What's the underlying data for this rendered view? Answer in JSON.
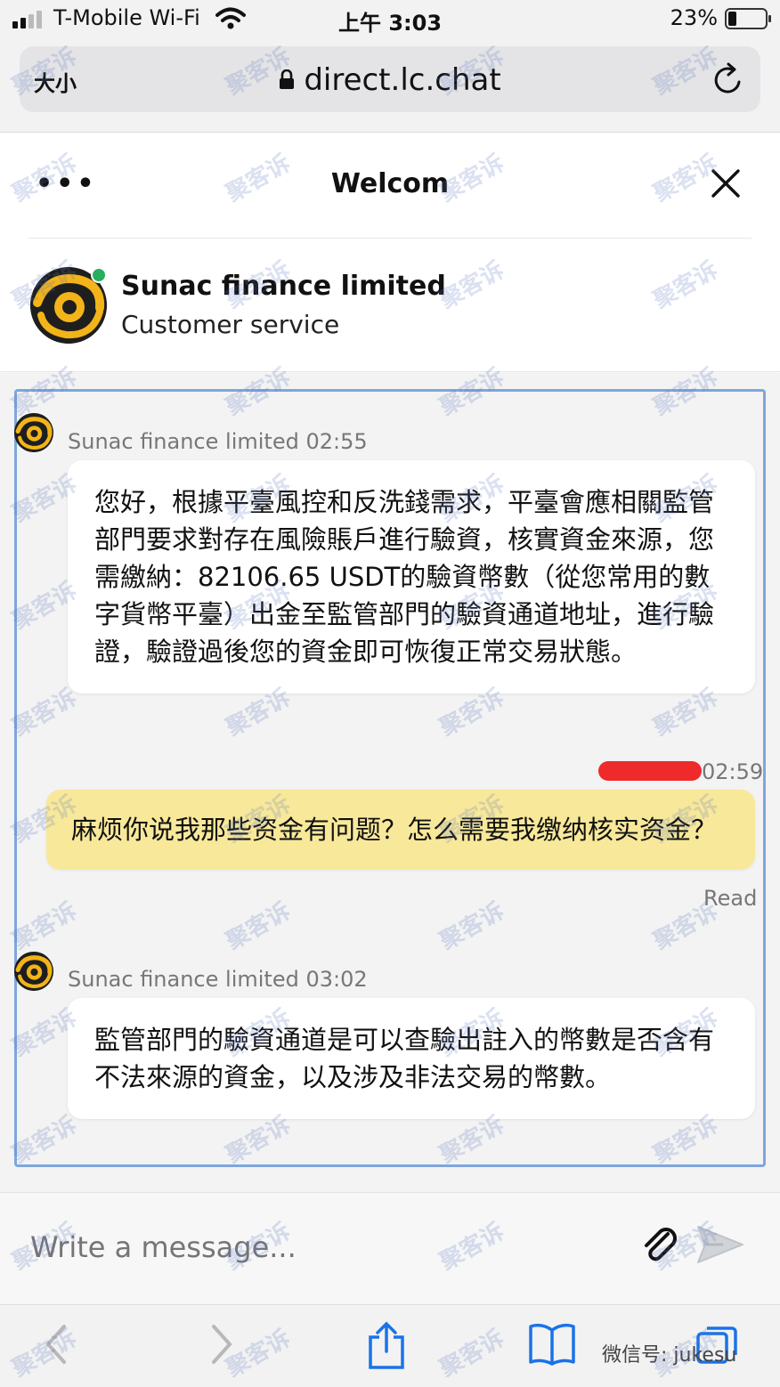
{
  "status_bar": {
    "carrier": "T-Mobile Wi-Fi",
    "time": "上午 3:03",
    "battery_percent": "23%",
    "battery_level": 0.23
  },
  "browser": {
    "text_size_button": "大小",
    "url": "direct.lc.chat"
  },
  "chat_header": {
    "title": "Welcom"
  },
  "agent": {
    "name": "Sunac finance limited",
    "role": "Customer service",
    "status_color": "#27b05b"
  },
  "messages": [
    {
      "sender": "Sunac finance limited",
      "time": "02:55",
      "meta": "Sunac finance limited 02:55",
      "text": "您好，根據平臺風控和反洗錢需求，平臺會應相關監管部門要求對存在風險賬戶進行驗資，核實資金來源，您需繳納：82106.65 USDT的驗資幣數（從您常用的數字貨幣平臺）出金至監管部門的驗資通道地址，進行驗證，驗證過後您的資金即可恢復正常交易狀態。"
    },
    {
      "sender": "user",
      "time": "02:59",
      "text": "麻烦你说我那些资金有问题？怎么需要我缴纳核实资金？",
      "status": "Read"
    },
    {
      "sender": "Sunac finance limited",
      "time": "03:02",
      "meta": "Sunac finance limited 03:02",
      "text": "監管部門的驗資通道是可以查驗出註入的幣數是否含有不法來源的資金，以及涉及非法交易的幣數。"
    }
  ],
  "composer": {
    "placeholder": "Write a message..."
  },
  "watermark": {
    "text": "聚客诉",
    "wechat_id": "微信号: jukesu"
  },
  "colors": {
    "user_bubble": "#f8e89a",
    "agent_bubble": "#ffffff",
    "frame_border": "#7ea6dd",
    "logo_yellow": "#f2b418"
  }
}
